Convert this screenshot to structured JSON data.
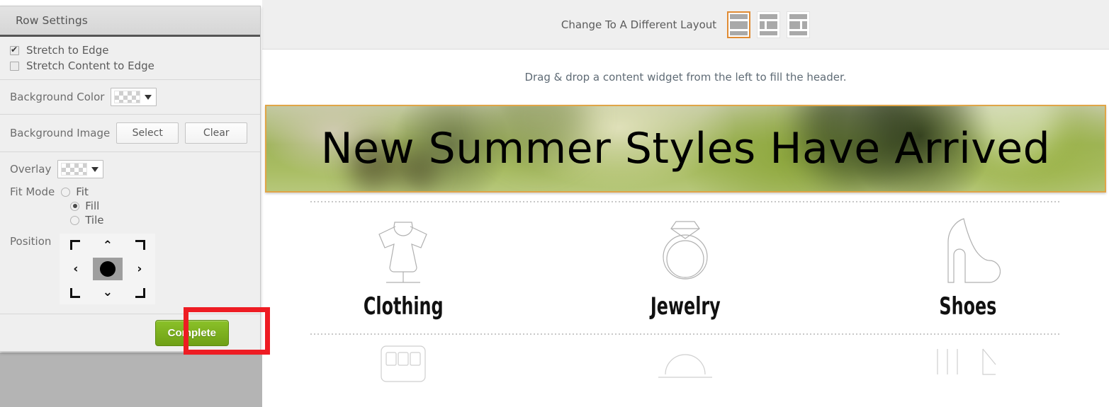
{
  "panel": {
    "title": "Row Settings",
    "checkboxes": [
      {
        "label": "Stretch to Edge",
        "checked": true
      },
      {
        "label": "Stretch Content to Edge",
        "checked": false
      }
    ],
    "background_color": {
      "label": "Background Color",
      "value": "transparent",
      "swatch": "checkerboard"
    },
    "background_image": {
      "label": "Background Image",
      "select_label": "Select",
      "clear_label": "Clear"
    },
    "overlay": {
      "label": "Overlay",
      "value": "transparent",
      "swatch": "checkerboard"
    },
    "fit_mode": {
      "label": "Fit Mode",
      "options": [
        "Fit",
        "Fill",
        "Tile"
      ],
      "selected": "Fill"
    },
    "position": {
      "label": "Position",
      "cells": [
        "top-left",
        "top",
        "top-right",
        "left",
        "center",
        "right",
        "bottom-left",
        "bottom",
        "bottom-right"
      ],
      "selected": "center"
    },
    "complete_label": "Complete",
    "highlight_color": "#ee1c23"
  },
  "toolbar": {
    "label": "Change To A Different Layout",
    "layouts": [
      {
        "name": "single-column",
        "selected": true
      },
      {
        "name": "two-column-left",
        "selected": false
      },
      {
        "name": "two-column-right",
        "selected": false
      }
    ],
    "accent_color": "#e08b33"
  },
  "canvas": {
    "drop_hint": "Drag & drop a content widget from the left to fill the header.",
    "banner": {
      "text": "New Summer Styles Have Arrived",
      "border_color": "#e0a547"
    },
    "categories": [
      {
        "label": "Clothing",
        "icon": "dress-icon"
      },
      {
        "label": "Jewelry",
        "icon": "ring-icon"
      },
      {
        "label": "Shoes",
        "icon": "high-heel-icon"
      }
    ],
    "categories_row2": [
      {
        "icon": "handbag-icon"
      },
      {
        "icon": "hat-icon"
      },
      {
        "icon": "accessories-icon"
      }
    ]
  }
}
